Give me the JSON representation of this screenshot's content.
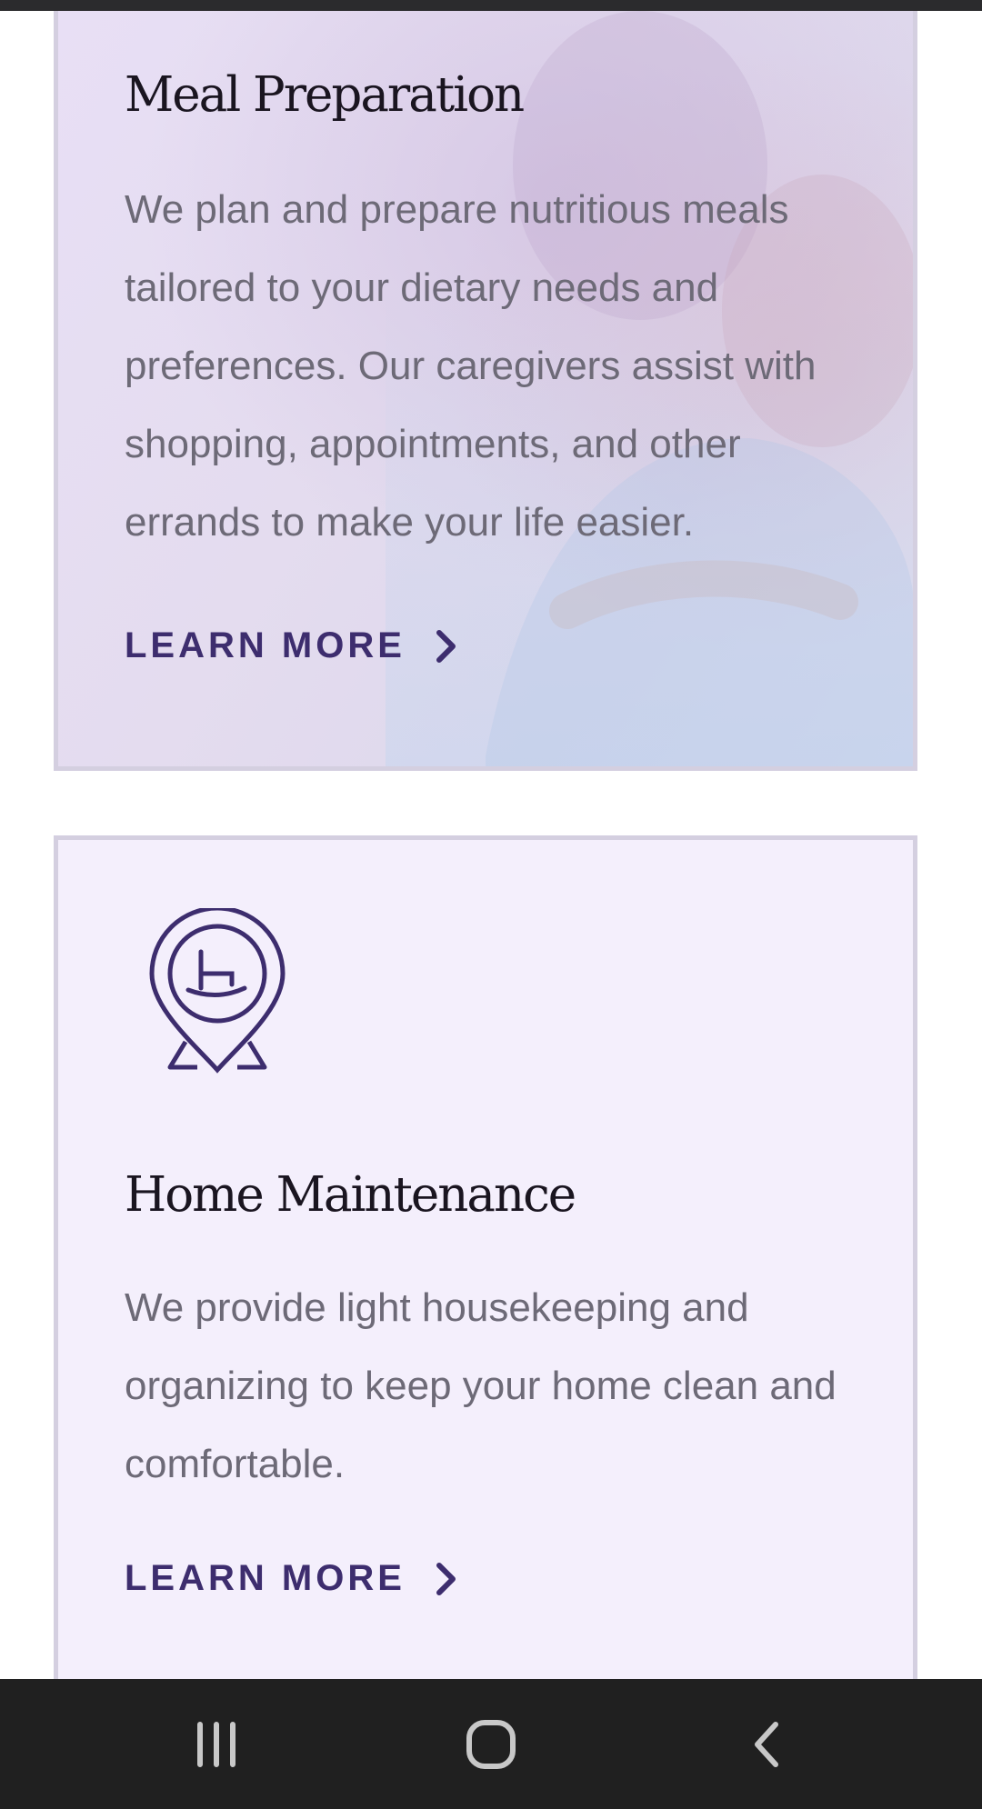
{
  "services": [
    {
      "title": "Meal Preparation",
      "description": "We plan and prepare nutritious meals tailored to your dietary needs and preferences. Our caregivers assist with shopping, appointments, and other errands to make your life easier.",
      "cta_label": "LEARN MORE"
    },
    {
      "title": "Home Maintenance",
      "description": "We provide light housekeeping and organizing to keep your home clean and comfortable.",
      "cta_label": "LEARN MORE",
      "icon": "rocking-chair-pin-icon"
    }
  ],
  "nav": {
    "recents_icon": "recent-apps-icon",
    "home_icon": "home-circle-icon",
    "back_icon": "back-chevron-icon"
  },
  "colors": {
    "accent": "#3d2d6e",
    "card_bg": "#f4effc",
    "card_border": "#d4cfe0",
    "body_text": "#6d6a77"
  }
}
